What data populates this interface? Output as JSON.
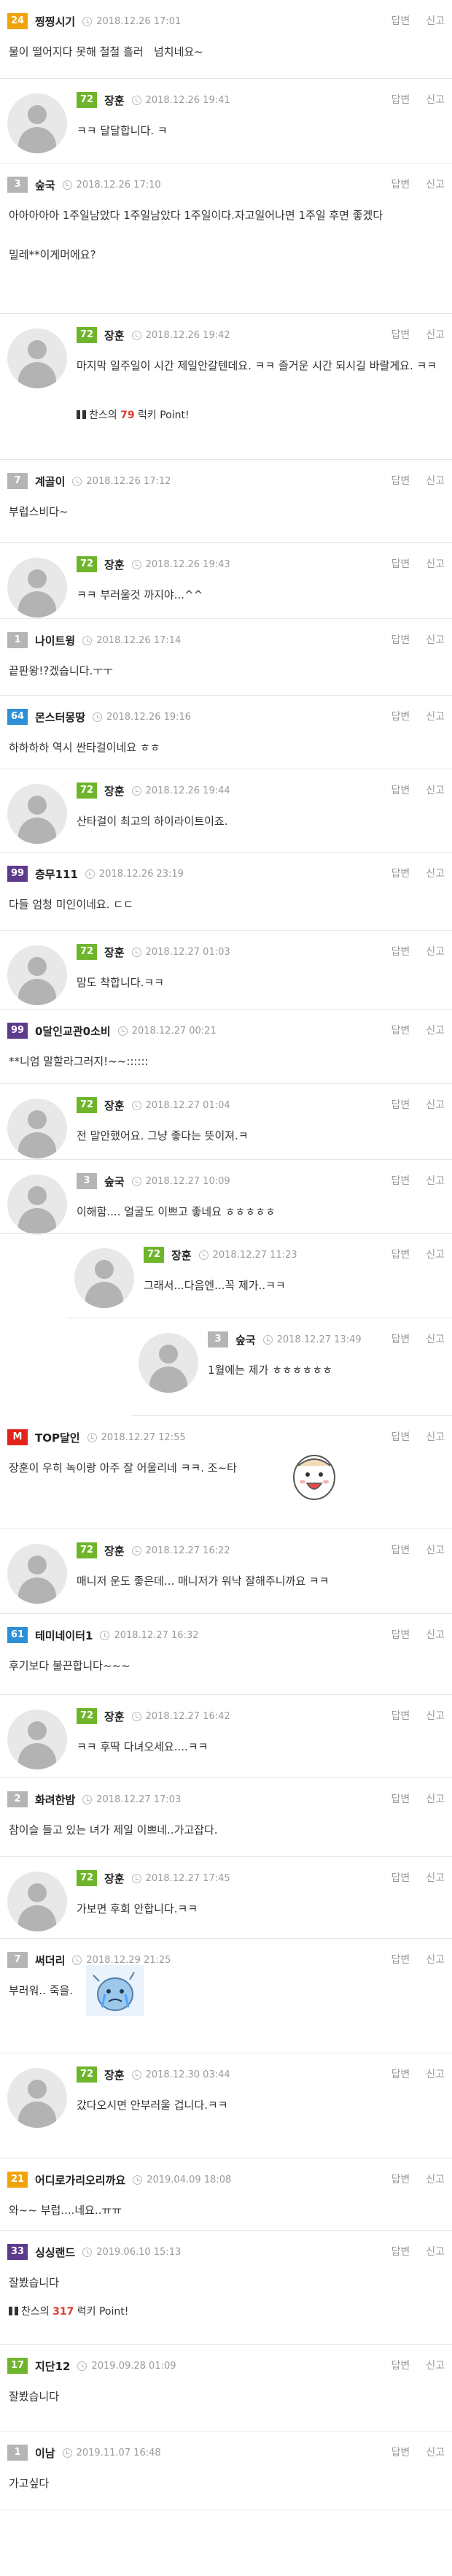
{
  "actions": {
    "reply": "답변",
    "report": "신고"
  },
  "point_suffix": "럭키 Point!",
  "comments": [
    {
      "level": "24",
      "level_color": "#f1a30a",
      "nick": "찡찡시기",
      "time": "2018.12.26 17:01",
      "text": "물이 떨어지다 못해 철철 흘러   넘치네요~"
    },
    {
      "reply": true,
      "level": "72",
      "level_color": "#6fb52c",
      "nick": "장훈",
      "time": "2018.12.26 19:41",
      "text": "ㅋㅋ 달달합니다. ㅋ"
    },
    {
      "level": "3",
      "level_color": "#b5b5b5",
      "nick": "숲국",
      "time": "2018.12.26 17:10",
      "text": "아아아아아 1주일남았다 1주일남았다 1주일이다.자고일어나면 1주일 후면 좋겠다\n\n밀레**이게머에요?"
    },
    {
      "reply": true,
      "level": "72",
      "level_color": "#6fb52c",
      "nick": "장훈",
      "time": "2018.12.26 19:42",
      "text": "마지막 일주일이 시간 제일안갈텐데요. ㅋㅋ 즐거운 시간 되시길 바랄게요. ㅋㅋ",
      "point_prefix": "찬스의",
      "point": "79"
    },
    {
      "level": "7",
      "level_color": "#b5b5b5",
      "nick": "계골이",
      "time": "2018.12.26 17:12",
      "text": "부럽스비다~"
    },
    {
      "reply": true,
      "level": "72",
      "level_color": "#6fb52c",
      "nick": "장훈",
      "time": "2018.12.26 19:43",
      "text": "ㅋㅋ 부러울것 까지야...^^"
    },
    {
      "level": "1",
      "level_color": "#b5b5b5",
      "nick": "나이트윙",
      "time": "2018.12.26 17:14",
      "text": "끝판왕!?겠습니다.ㅜㅜ"
    },
    {
      "level": "64",
      "level_color": "#2d8fd5",
      "nick": "몬스터몽땅",
      "time": "2018.12.26 19:16",
      "text": "하하하하 역시 싼타걸이네요 ㅎㅎ"
    },
    {
      "reply": true,
      "level": "72",
      "level_color": "#6fb52c",
      "nick": "장훈",
      "time": "2018.12.26 19:44",
      "text": "산타걸이 최고의 하이라이트이죠."
    },
    {
      "level": "99",
      "level_color": "#5d3a8c",
      "nick": "층무111",
      "time": "2018.12.26 23:19",
      "text": "다들 엄청 미인이네요. ㄷㄷ"
    },
    {
      "reply": true,
      "level": "72",
      "level_color": "#6fb52c",
      "nick": "장훈",
      "time": "2018.12.27 01:03",
      "text": "맘도 착합니다.ㅋㅋ"
    },
    {
      "level": "99",
      "level_color": "#5d3a8c",
      "nick": "0달인교관0소비",
      "time": "2018.12.27 00:21",
      "text": "**니엄 말할라그러지!~~::::::"
    },
    {
      "reply": true,
      "level": "72",
      "level_color": "#6fb52c",
      "nick": "장훈",
      "time": "2018.12.27 01:04",
      "text": "전 말안했어요. 그냥 좋다는 뜻이져.ㅋ"
    },
    {
      "reply": true,
      "level": "3",
      "level_color": "#b5b5b5",
      "nick": "숲국",
      "time": "2018.12.27 10:09",
      "text": "이해함.... 얼굴도 이쁘고 좋네요 ㅎㅎㅎㅎㅎ"
    },
    {
      "reply": true,
      "depth": 2,
      "level": "72",
      "level_color": "#6fb52c",
      "nick": "장훈",
      "time": "2018.12.27 11:23",
      "text": "그래서...다음엔...꼭 제가..ㅋㅋ"
    },
    {
      "reply": true,
      "depth": 3,
      "level": "3",
      "level_color": "#b5b5b5",
      "nick": "숲국",
      "time": "2018.12.27 13:49",
      "text": "1월에는 제가 ㅎㅎㅎㅎㅎㅎ"
    },
    {
      "level": "M",
      "level_color": "#e2231a",
      "nick": "TOP달인",
      "time": "2018.12.27 12:55",
      "text": "장훈이 우히 녹이랑 아주 잘 어울리네 ㅋㅋ. 조~타",
      "emoticon": "happy"
    },
    {
      "reply": true,
      "level": "72",
      "level_color": "#6fb52c",
      "nick": "장훈",
      "time": "2018.12.27 16:22",
      "text": "매니저 운도 좋은데... 매니저가 워낙 잘해주니까요 ㅋㅋ"
    },
    {
      "level": "61",
      "level_color": "#2d8fd5",
      "nick": "테미네이터1",
      "time": "2018.12.27 16:32",
      "text": "후기보다 불끈합니다~~~"
    },
    {
      "reply": true,
      "level": "72",
      "level_color": "#6fb52c",
      "nick": "장훈",
      "time": "2018.12.27 16:42",
      "text": "ㅋㅋ 후딱 다녀오세요....ㅋㅋ"
    },
    {
      "level": "2",
      "level_color": "#b5b5b5",
      "nick": "화려한밤",
      "time": "2018.12.27 17:03",
      "text": "참이슬 들고 있는 녀가 제일 이쁘네..가고잡다."
    },
    {
      "reply": true,
      "level": "72",
      "level_color": "#6fb52c",
      "nick": "장훈",
      "time": "2018.12.27 17:45",
      "text": "가보면 후회 안합니다.ㅋㅋ"
    },
    {
      "level": "7",
      "level_color": "#b5b5b5",
      "nick": "써더리",
      "time": "2018.12.29 21:25",
      "text": "부러워.. 죽을.",
      "emoticon": "cry"
    },
    {
      "reply": true,
      "level": "72",
      "level_color": "#6fb52c",
      "nick": "장훈",
      "time": "2018.12.30 03:44",
      "text": "갔다오시면 안부러울 겁니다.ㅋㅋ"
    },
    {
      "level": "21",
      "level_color": "#f1a30a",
      "nick": "어디로가리오리까요",
      "time": "2019.04.09 18:08",
      "text": "와~~ 부럽....네요..ㅠㅠ"
    },
    {
      "level": "33",
      "level_color": "#5d3a8c",
      "nick": "싱싱랜드",
      "time": "2019.06.10 15:13",
      "text": "잘봤습니다",
      "point_prefix": "찬스의",
      "point": "317"
    },
    {
      "level": "17",
      "level_color": "#6fb52c",
      "nick": "지단12",
      "time": "2019.09.28 01:09",
      "text": "잘봤습니다"
    },
    {
      "level": "1",
      "level_color": "#b5b5b5",
      "nick": "이남",
      "time": "2019.11.07 16:48",
      "text": "가고싶다"
    }
  ]
}
